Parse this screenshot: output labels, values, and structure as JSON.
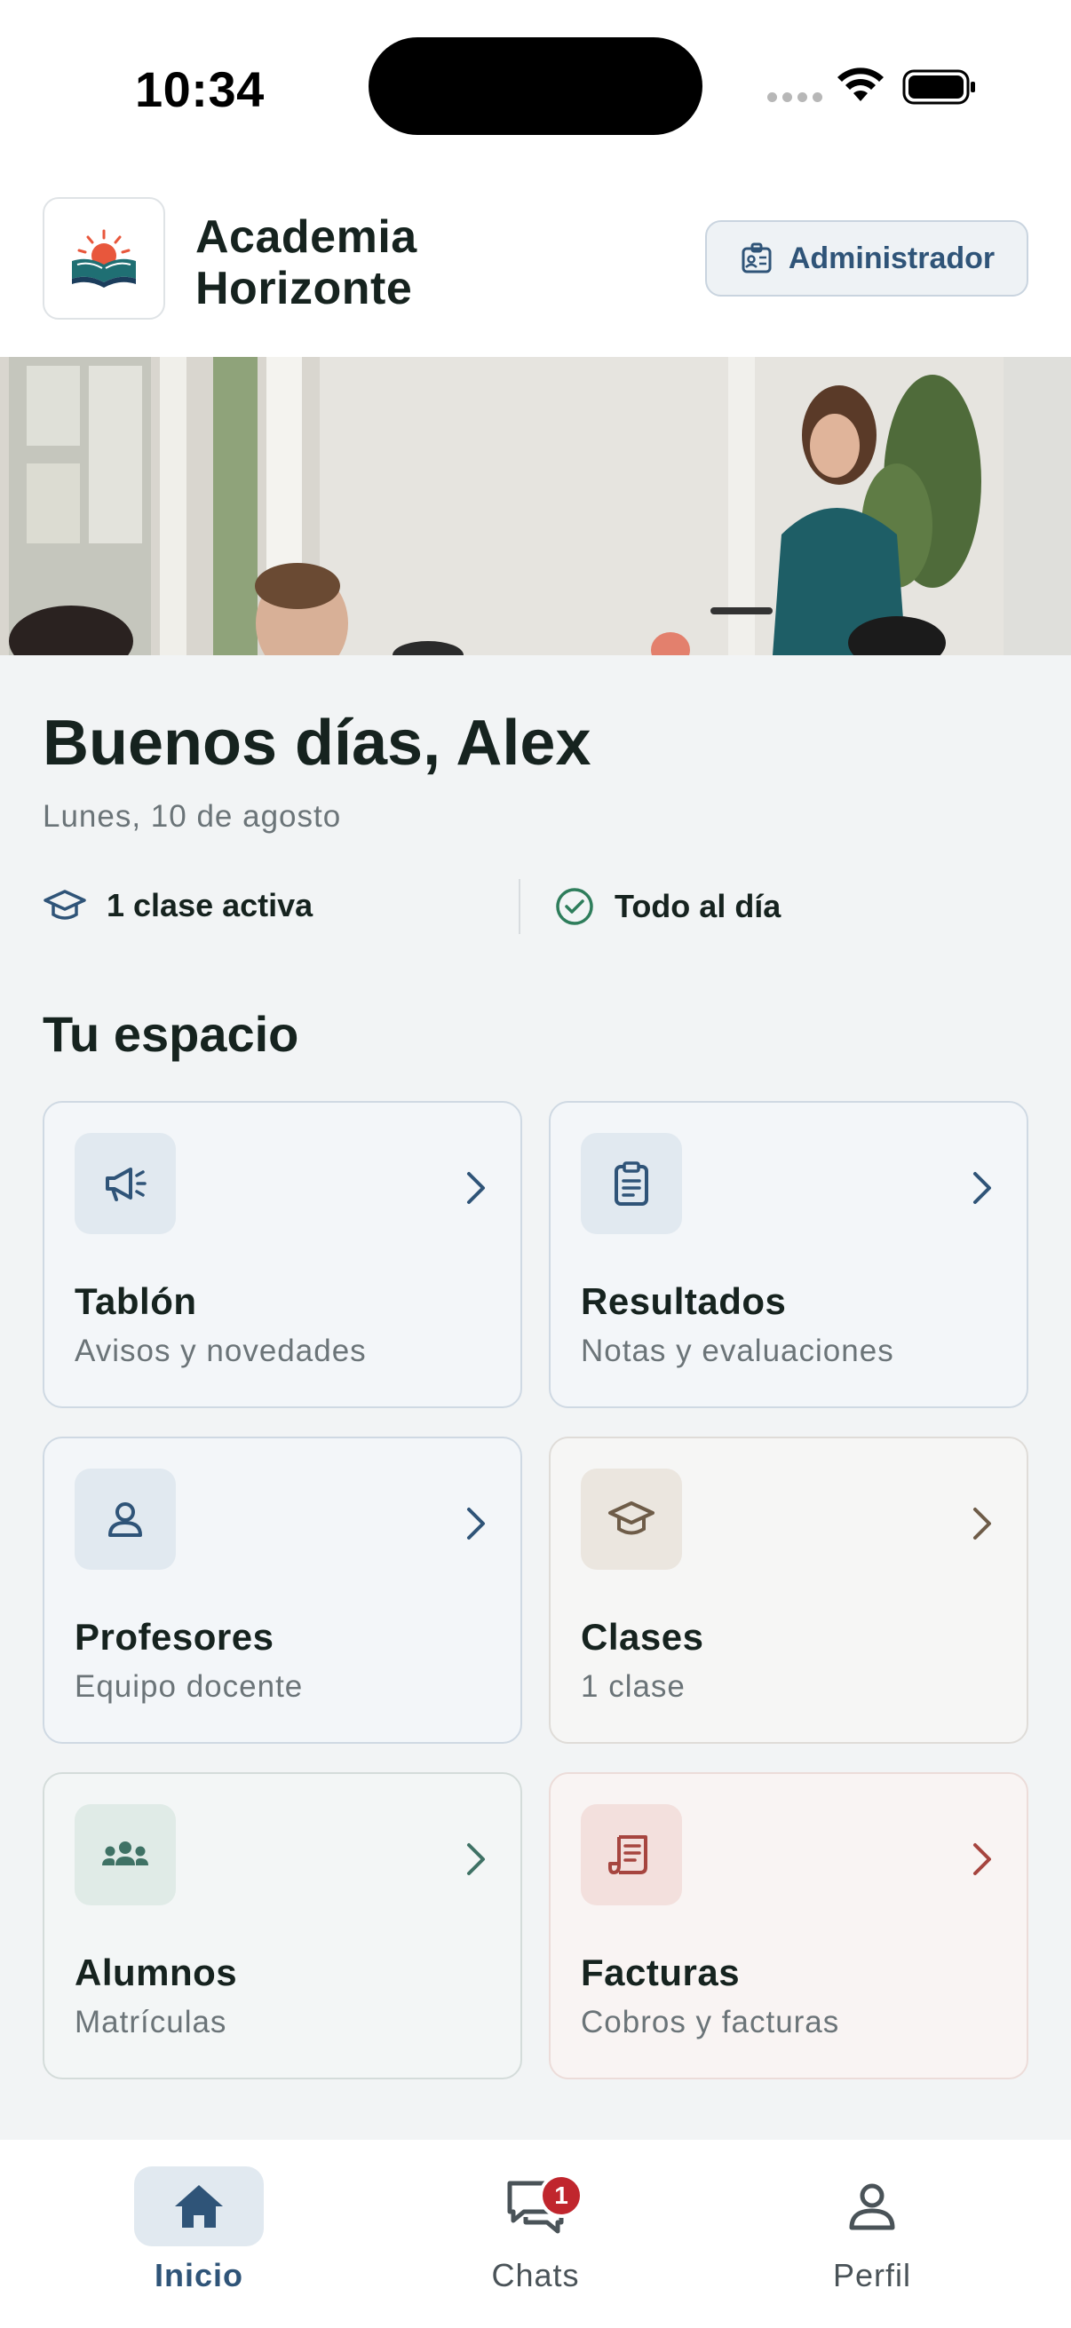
{
  "status_bar": {
    "time": "10:34"
  },
  "header": {
    "school_name_line1": "Academia",
    "school_name_line2": "Horizonte",
    "role_label": "Administrador"
  },
  "welcome": {
    "greeting": "Buenos días, Alex",
    "date": "Lunes, 10 de agosto",
    "stat_classes": "1 clase activa",
    "stat_status": "Todo al día"
  },
  "section": {
    "title": "Tu espacio"
  },
  "cards": [
    {
      "title": "Tablón",
      "subtitle": "Avisos y novedades",
      "icon": "megaphone-icon",
      "accent": "#2f5478"
    },
    {
      "title": "Resultados",
      "subtitle": "Notas y evaluaciones",
      "icon": "clipboard-icon",
      "accent": "#2f5478"
    },
    {
      "title": "Profesores",
      "subtitle": "Equipo docente",
      "icon": "person-icon",
      "accent": "#2f5478"
    },
    {
      "title": "Clases",
      "subtitle": "1 clase",
      "icon": "graduation-cap-icon",
      "accent": "#6e5c48"
    },
    {
      "title": "Alumnos",
      "subtitle": "Matrículas",
      "icon": "group-icon",
      "accent": "#3f7265"
    },
    {
      "title": "Facturas",
      "subtitle": "Cobros y facturas",
      "icon": "receipt-icon",
      "accent": "#a6453f"
    }
  ],
  "tabbar": {
    "tabs": [
      {
        "label": "Inicio",
        "icon": "home-icon",
        "active": true
      },
      {
        "label": "Chats",
        "icon": "chat-icon",
        "badge": "1"
      },
      {
        "label": "Perfil",
        "icon": "user-icon"
      }
    ]
  },
  "colors": {
    "primary": "#2f5478",
    "success": "#2e7d5b",
    "badge": "#c0262d",
    "background": "#f2f4f5"
  }
}
